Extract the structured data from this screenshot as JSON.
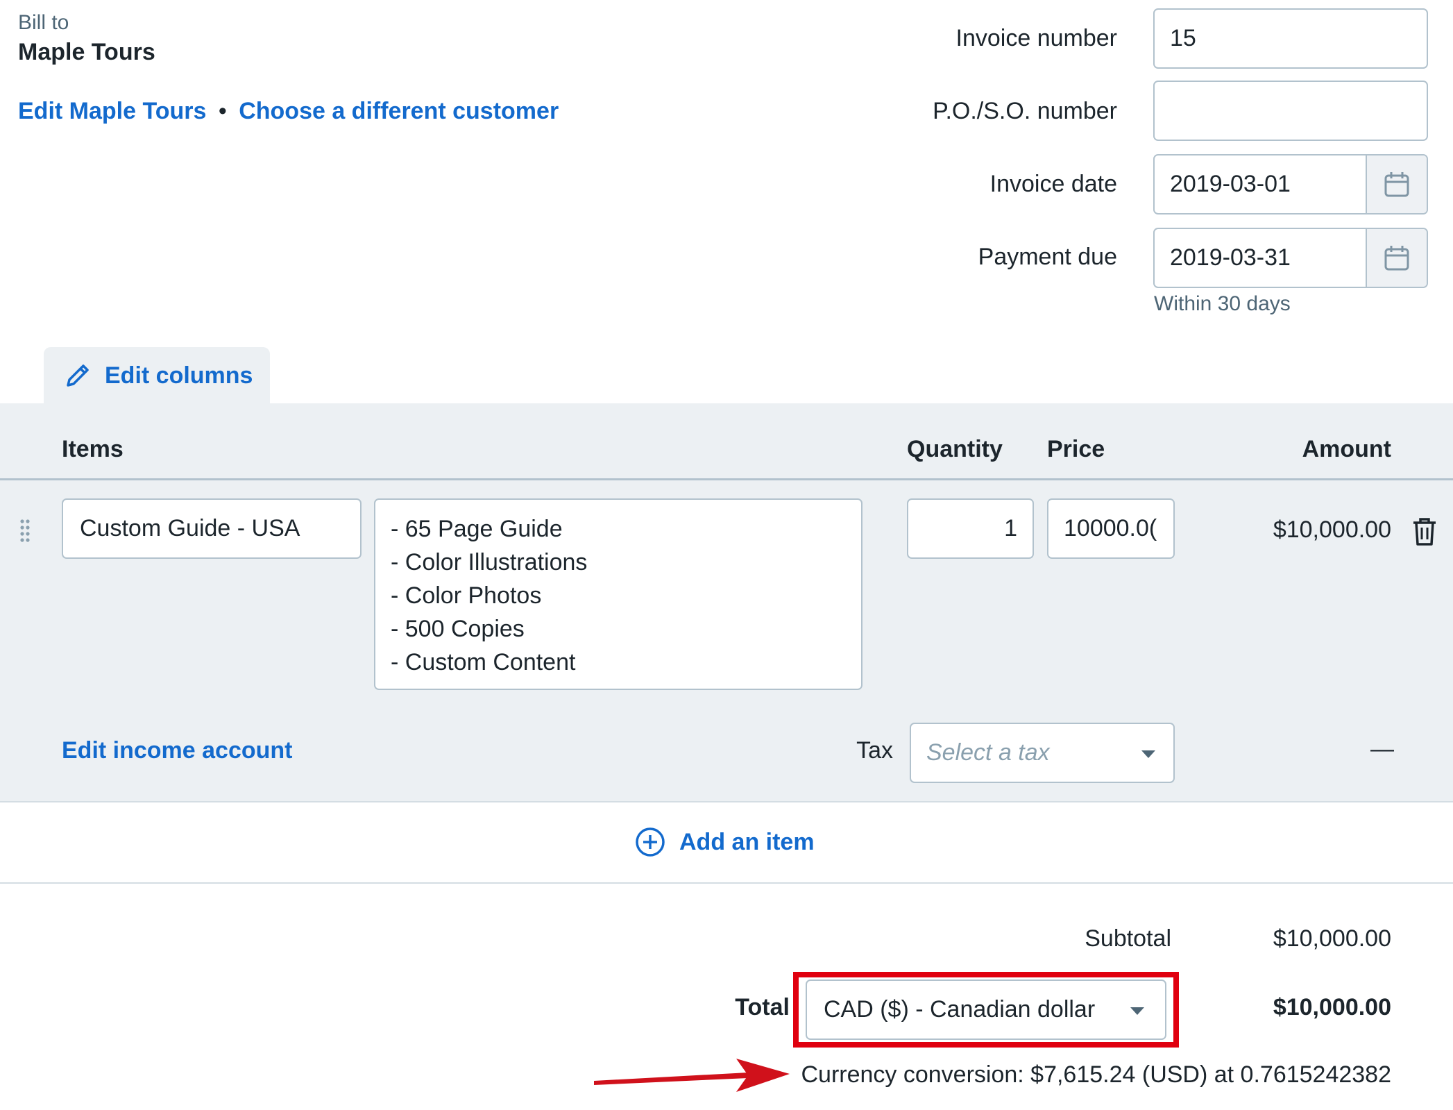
{
  "bill_to": {
    "label": "Bill to",
    "customer_name": "Maple Tours",
    "edit_link": "Edit Maple Tours",
    "separator": "•",
    "choose_link": "Choose a different customer"
  },
  "invoice_fields": {
    "invoice_number": {
      "label": "Invoice number",
      "value": "15"
    },
    "po_number": {
      "label": "P.O./S.O. number",
      "value": ""
    },
    "invoice_date": {
      "label": "Invoice date",
      "value": "2019-03-01"
    },
    "payment_due": {
      "label": "Payment due",
      "value": "2019-03-31",
      "hint": "Within 30 days"
    }
  },
  "edit_columns": {
    "label": "Edit columns"
  },
  "table": {
    "headers": {
      "items": "Items",
      "quantity": "Quantity",
      "price": "Price",
      "amount": "Amount"
    },
    "rows": [
      {
        "item_name": "Custom Guide - USA",
        "description_lines": [
          "- 65 Page Guide",
          "- Color Illustrations",
          "- Color Photos",
          "- 500 Copies",
          "- Custom Content"
        ],
        "quantity": "1",
        "price": "10000.0(",
        "amount": "$10,000.00",
        "edit_income_account": "Edit income account",
        "tax_label": "Tax",
        "tax_placeholder": "Select a tax",
        "tax_amount": "—"
      }
    ]
  },
  "add_item": {
    "label": "Add an item"
  },
  "totals": {
    "subtotal_label": "Subtotal",
    "subtotal_value": "$10,000.00",
    "total_label": "Total",
    "currency_selected": "CAD ($) - Canadian dollar",
    "total_value": "$10,000.00",
    "conversion_text": "Currency conversion: $7,615.24 (USD) at 0.7615242382"
  },
  "colors": {
    "link": "#136acd",
    "panel_bg": "#ecf0f3",
    "border": "#b2c2cd",
    "highlight": "#e0000f",
    "arrow": "#d0111b"
  },
  "icons": [
    "calendar-icon",
    "pencil-icon",
    "drag-handle-icon",
    "trash-icon",
    "plus-circle-icon",
    "chevron-down-icon",
    "annotation-arrow"
  ]
}
